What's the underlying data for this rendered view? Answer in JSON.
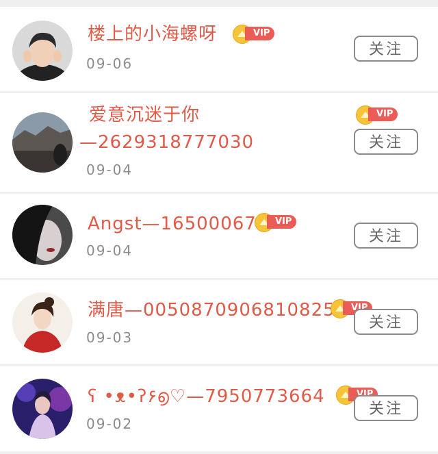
{
  "follow_label": "关注",
  "vip_label": "VIP",
  "users": [
    {
      "name": "楼上的小海螺呀",
      "date": "09-06"
    },
    {
      "name": "爱意沉迷于你",
      "name_line2": "—2629318777030",
      "date": "09-04"
    },
    {
      "name": "Angst—165000676",
      "date": "09-04"
    },
    {
      "name": "满唐—00508709068108257",
      "date": "09-03"
    },
    {
      "name": "ʕ •ᴥ•ʔ۶൭♡—7950773664",
      "date": "09-02"
    }
  ],
  "colors": {
    "name": "#e05a47",
    "vip_badge": "#ec5c56",
    "crown": "#f6c339",
    "date": "#8c8c8c",
    "divider": "#efefef"
  }
}
